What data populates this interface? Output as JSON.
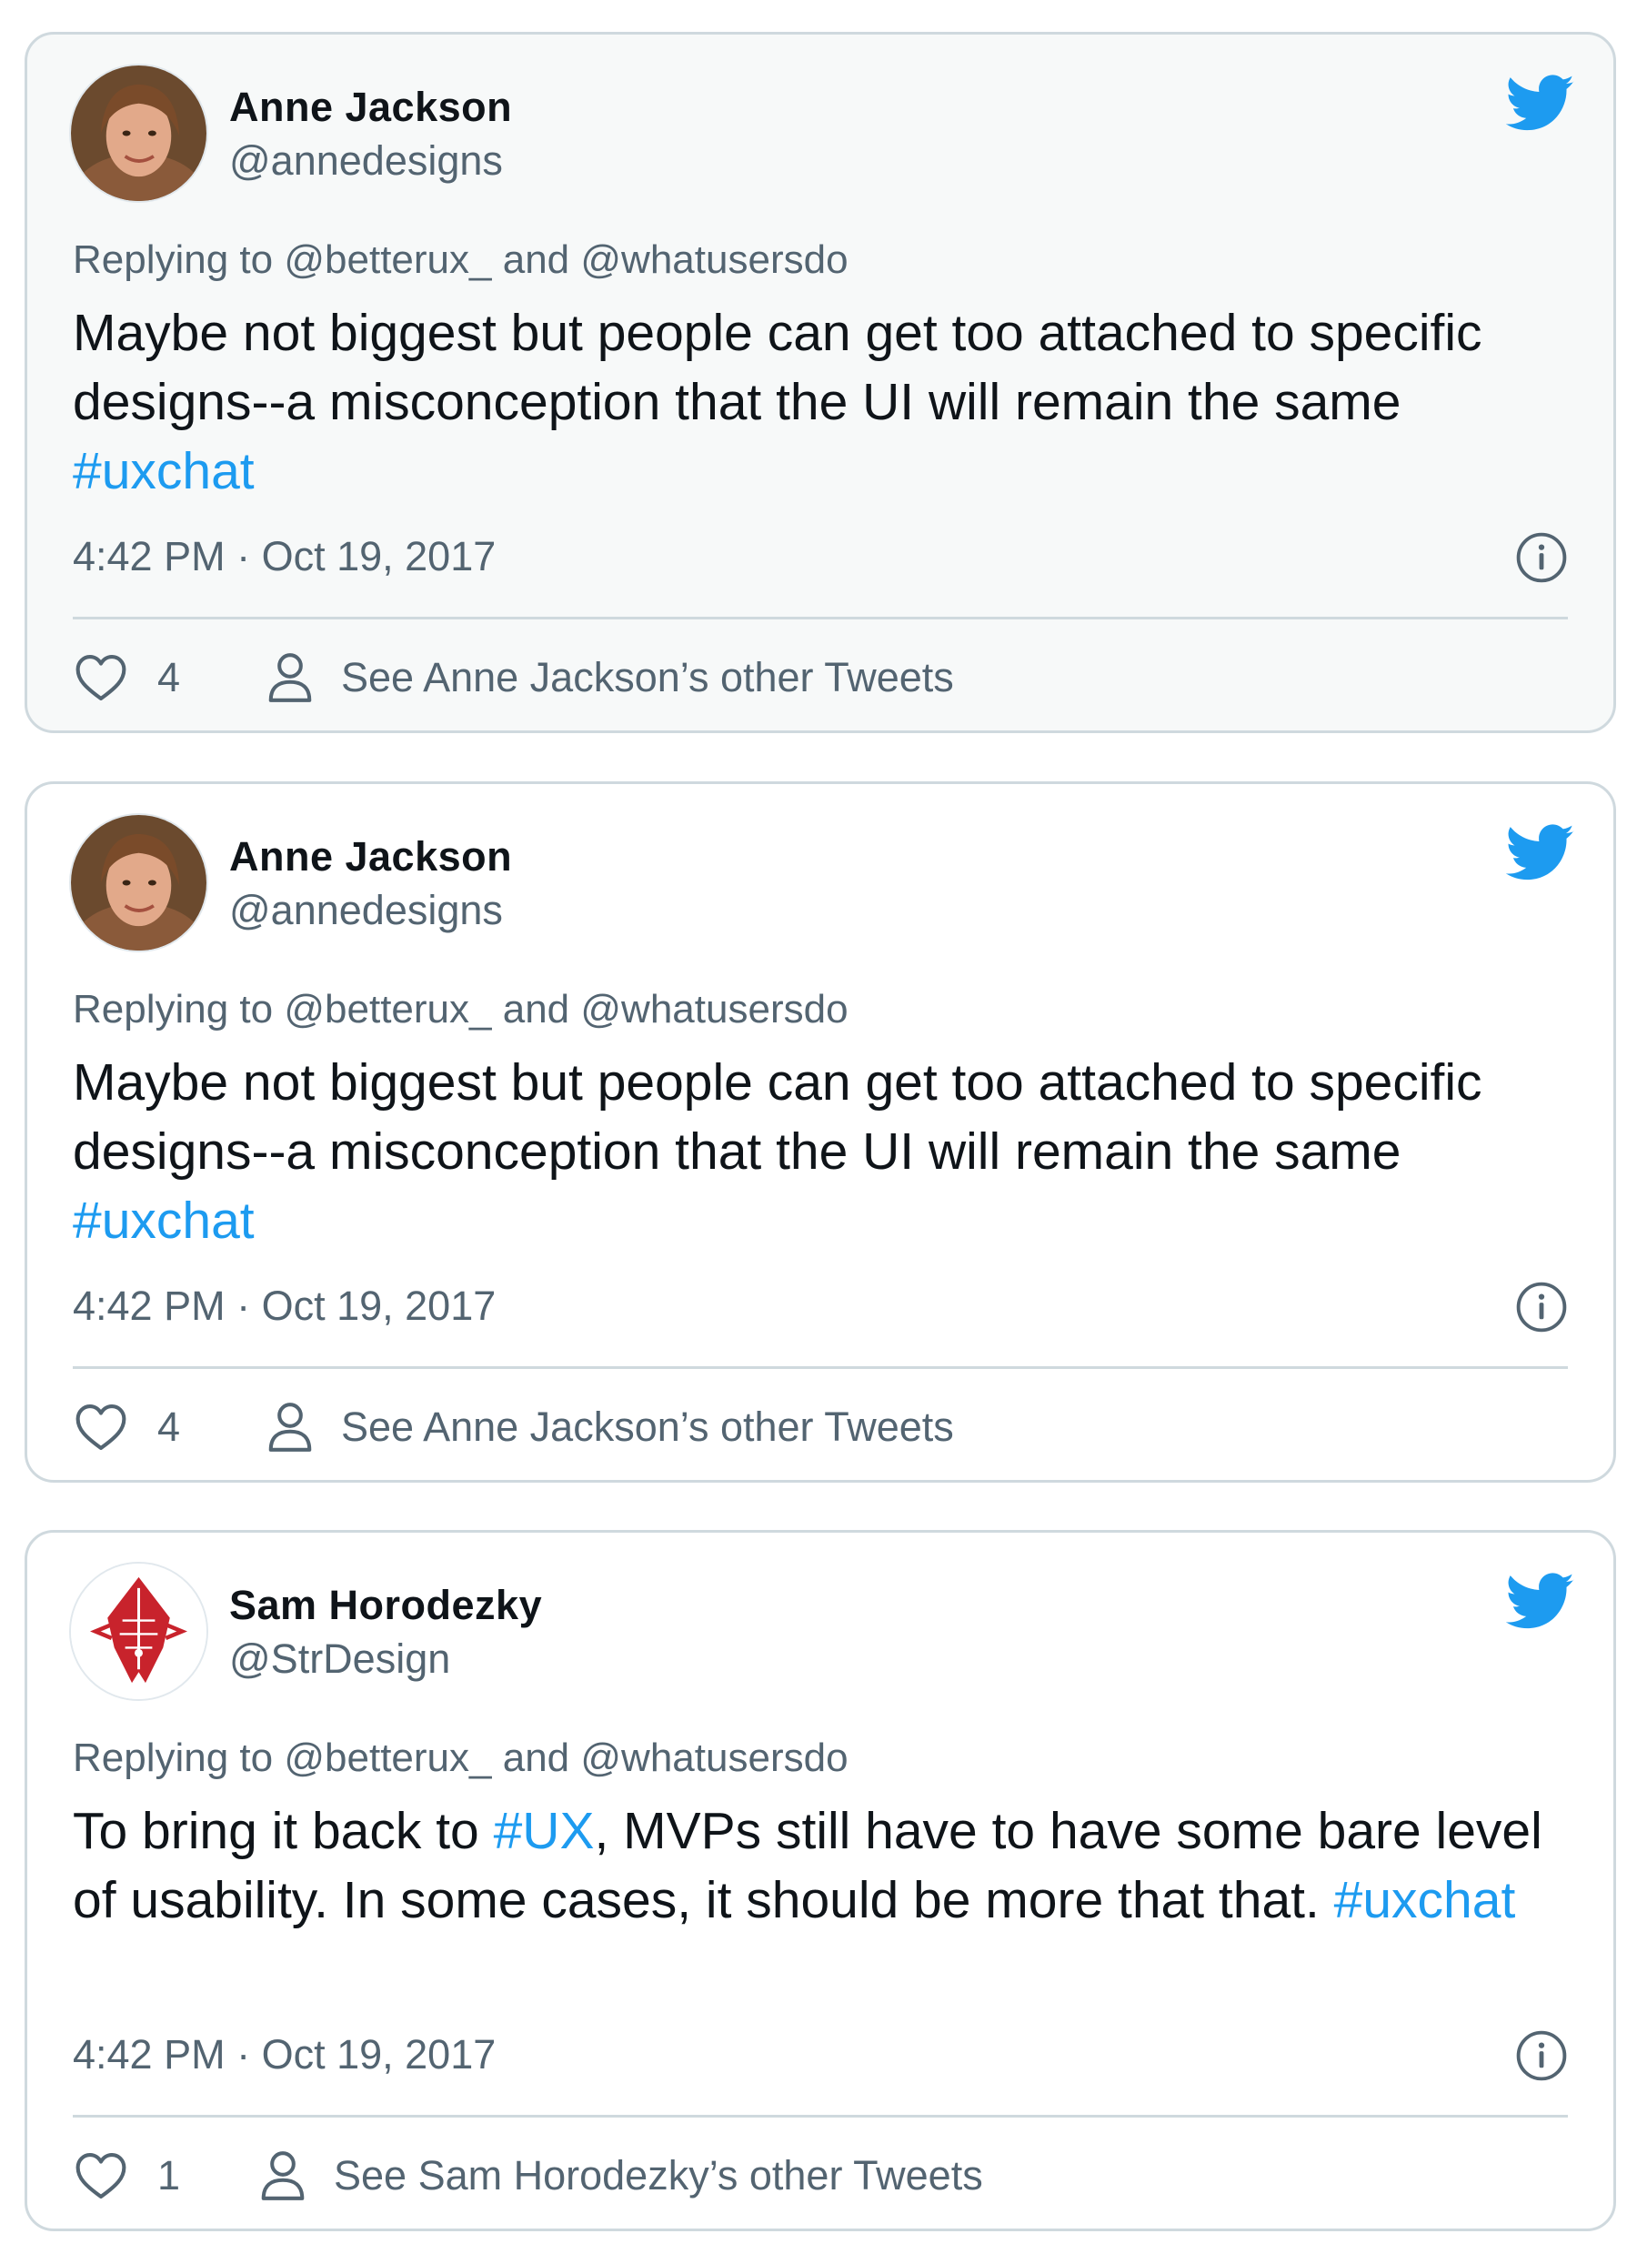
{
  "colors": {
    "accent": "#1d9bf0",
    "text_primary": "#0f1419",
    "text_secondary": "#536471",
    "border": "#cfd9de",
    "highlight_bg": "#f7f9f9"
  },
  "tweets": [
    {
      "author_name": "Anne Jackson",
      "handle": "@annedesigns",
      "avatar_icon": "profile-photo",
      "reply_prefix": "Replying to",
      "reply_user1": "@betterux_",
      "reply_and": "and",
      "reply_user2": "@whatusersdo",
      "text": "Maybe not biggest but people can get too attached to specific designs--a misconception that the UI will remain the same",
      "hashtag": "#uxchat",
      "timestamp": "4:42 PM · Oct 19, 2017",
      "likes": "4",
      "see_other": "See Anne Jackson’s other Tweets"
    },
    {
      "author_name": "Anne Jackson",
      "handle": "@annedesigns",
      "avatar_icon": "profile-photo",
      "reply_prefix": "Replying to",
      "reply_user1": "@betterux_",
      "reply_and": "and",
      "reply_user2": "@whatusersdo",
      "text": "Maybe not biggest but people can get too attached to specific designs--a misconception that the UI will remain the same",
      "hashtag": "#uxchat",
      "timestamp": "4:42 PM · Oct 19, 2017",
      "likes": "4",
      "see_other": "See Anne Jackson’s other Tweets"
    },
    {
      "author_name": "Sam Horodezky",
      "handle": "@StrDesign",
      "avatar_icon": "red-pen-nib-logo",
      "reply_prefix": "Replying to",
      "reply_user1": "@betterux_",
      "reply_and": "and",
      "reply_user2": "@whatusersdo",
      "text_part1": "To bring it back to",
      "hashtag_inline": "#UX",
      "text_part2": ", MVPs still have to have some bare level of usability. In some cases, it should be more that that.",
      "hashtag": "#uxchat",
      "timestamp": "4:42 PM · Oct 19, 2017",
      "likes": "1",
      "see_other": "See Sam Horodezky’s other Tweets"
    }
  ]
}
